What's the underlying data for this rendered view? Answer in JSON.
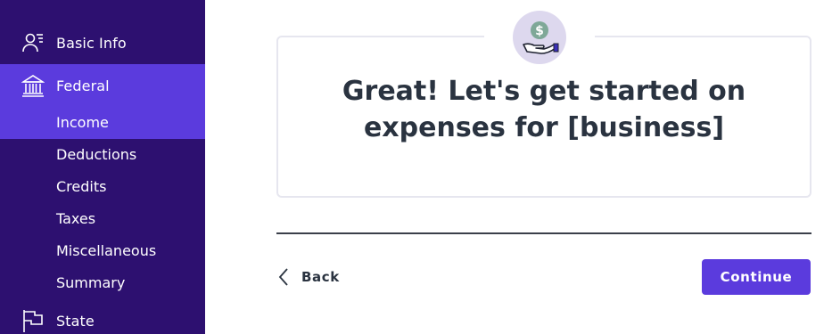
{
  "sidebar": {
    "basic_info": {
      "label": "Basic Info",
      "icon": "person-list-icon"
    },
    "federal": {
      "label": "Federal",
      "icon": "bank-building-icon",
      "items": [
        {
          "label": "Income",
          "active": true
        },
        {
          "label": "Deductions"
        },
        {
          "label": "Credits"
        },
        {
          "label": "Taxes"
        },
        {
          "label": "Miscellaneous"
        },
        {
          "label": "Summary"
        }
      ]
    },
    "state": {
      "label": "State",
      "icon": "flag-icon"
    }
  },
  "main": {
    "badge_icon": "hand-money-icon",
    "heading_line1": "Great! Let's get started on",
    "heading_line2": "expenses for [business]",
    "back_label": "Back",
    "continue_label": "Continue"
  },
  "colors": {
    "sidebar_bg": "#2d1070",
    "accent": "#5b3bdd",
    "badge_bg": "#ddd8ee",
    "dollar_green": "#7fa898",
    "text_dark": "#2a3340"
  }
}
